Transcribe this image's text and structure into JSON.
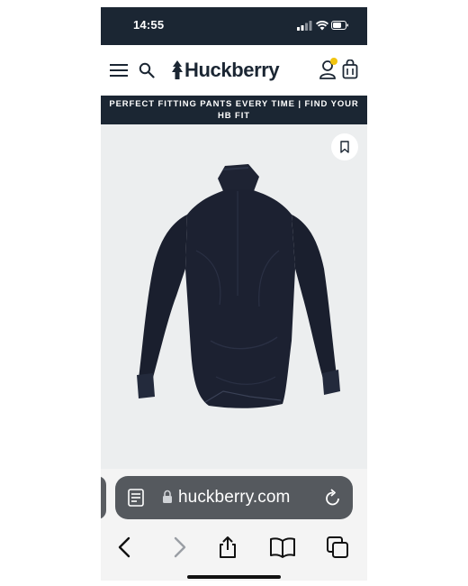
{
  "status_bar": {
    "time": "14:55",
    "icons": [
      "cellular-signal-icon",
      "wifi-icon",
      "battery-icon"
    ]
  },
  "header": {
    "brand": "Huckberry",
    "icons": [
      "menu-icon",
      "search-icon",
      "tree-logo-icon",
      "account-icon",
      "bag-icon"
    ],
    "badge_color": "#f1c40f"
  },
  "banner": {
    "text": "PERFECT FITTING PANTS EVERY TIME | FIND YOUR HB FIT"
  },
  "product": {
    "image_alt": "Navy jacket, back view",
    "bookmark_icon": "bookmark-icon"
  },
  "browser": {
    "url": "huckberry.com",
    "icons": [
      "reader-icon",
      "lock-icon",
      "reload-icon"
    ],
    "toolbar": [
      "back-icon",
      "forward-icon",
      "share-icon",
      "bookmarks-icon",
      "tabs-icon"
    ]
  },
  "colors": {
    "navy": "#1b2633",
    "product_bg": "#eceeef",
    "address_bar": "#55595e"
  }
}
